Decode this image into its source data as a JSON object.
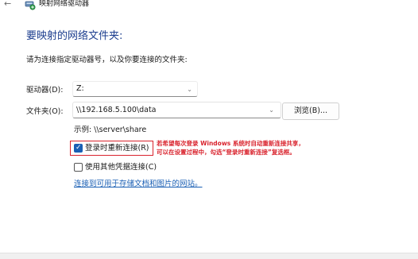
{
  "window": {
    "back_glyph": "←",
    "title": "映射网络驱动器",
    "icon": "network-drive-icon"
  },
  "main": {
    "heading": "要映射的网络文件夹:",
    "instruction": "请为连接指定驱动器号，以及你要连接的文件夹:",
    "drive_label": "驱动器(D):",
    "drive_value": "Z:",
    "folder_label": "文件夹(O):",
    "folder_value": "\\\\192.168.5.100\\data",
    "browse_label": "浏览(B)...",
    "example": "示例: \\\\server\\share",
    "reconnect_label": "登录时重新连接(R)",
    "reconnect_checked": true,
    "credentials_label": "使用其他凭据连接(C)",
    "credentials_checked": false,
    "link": "连接到可用于存储文档和图片的网站。"
  },
  "annotation": {
    "line1": "若希望每次登录 Windows 系统时自动重新连接共享，",
    "line2": "可以在设置过程中，勾选“登录时重新连接”复选框。",
    "color": "#d9232d"
  },
  "colors": {
    "heading": "#1e3f8f",
    "link": "#1a5fb4",
    "checkbox": "#1a5fb4"
  }
}
